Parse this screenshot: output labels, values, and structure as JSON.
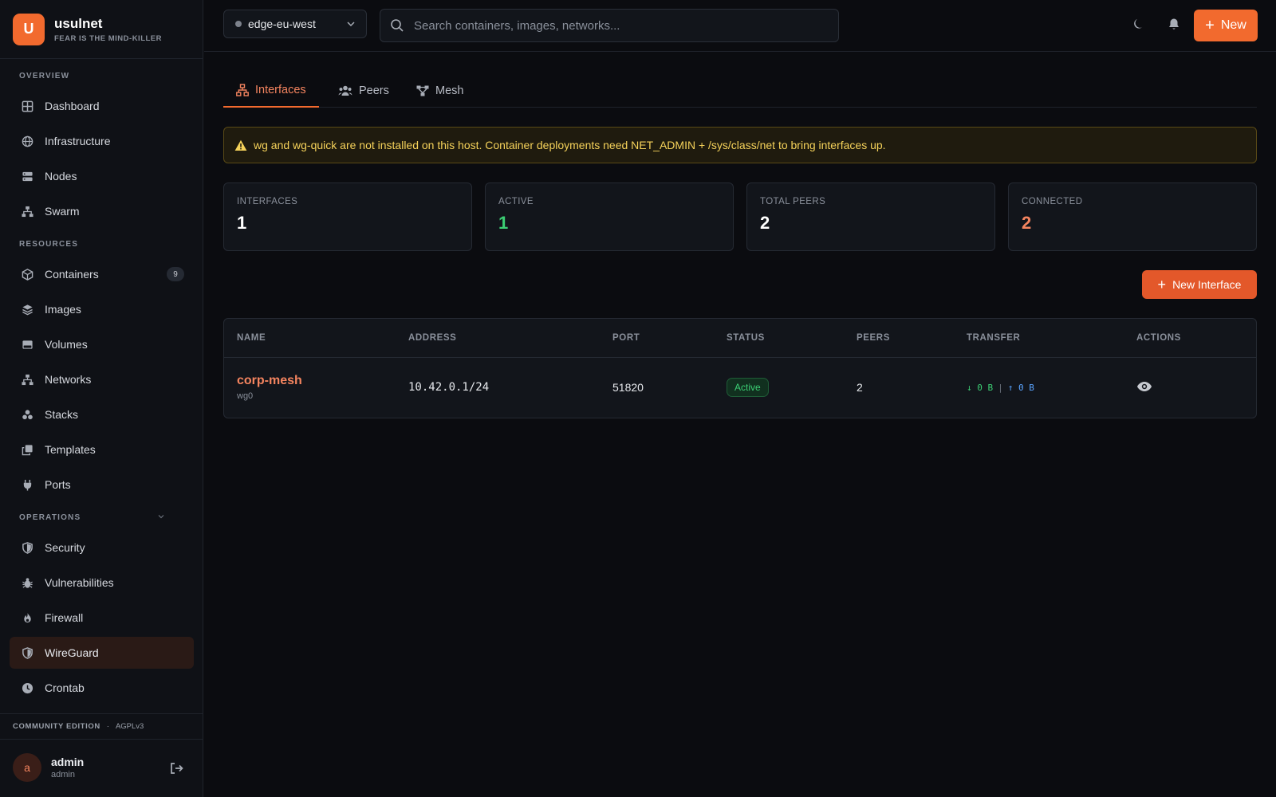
{
  "brand": {
    "logo_letter": "U",
    "name": "usulnet",
    "tagline": "FEAR IS THE MIND-KILLER"
  },
  "sidebar": {
    "sections": [
      {
        "label": "OVERVIEW"
      },
      {
        "label": "RESOURCES"
      },
      {
        "label": "OPERATIONS"
      }
    ],
    "items": [
      {
        "label": "Dashboard",
        "icon": "grid-icon"
      },
      {
        "label": "Infrastructure",
        "icon": "globe-icon"
      },
      {
        "label": "Nodes",
        "icon": "server-icon"
      },
      {
        "label": "Swarm",
        "icon": "network-icon"
      },
      {
        "label": "Containers",
        "icon": "box-icon",
        "badge": "9"
      },
      {
        "label": "Images",
        "icon": "layers-icon"
      },
      {
        "label": "Volumes",
        "icon": "hard-drive-icon"
      },
      {
        "label": "Networks",
        "icon": "network-icon"
      },
      {
        "label": "Stacks",
        "icon": "cubes-icon"
      },
      {
        "label": "Templates",
        "icon": "copy-icon"
      },
      {
        "label": "Ports",
        "icon": "plug-icon"
      },
      {
        "label": "Security",
        "icon": "shield-icon"
      },
      {
        "label": "Vulnerabilities",
        "icon": "bug-icon"
      },
      {
        "label": "Firewall",
        "icon": "fire-icon"
      },
      {
        "label": "WireGuard",
        "icon": "shield-icon",
        "active": true
      },
      {
        "label": "Crontab",
        "icon": "clock-icon"
      }
    ],
    "footer": {
      "edition": "COMMUNITY EDITION",
      "separator": "·",
      "license": "AGPLv3"
    },
    "user": {
      "initial": "a",
      "name": "admin",
      "role": "admin"
    }
  },
  "topbar": {
    "host": "edge-eu-west",
    "search_placeholder": "Search containers, images, networks...",
    "new_label": "New"
  },
  "tabs": [
    {
      "label": "Interfaces",
      "icon": "network-icon",
      "active": true
    },
    {
      "label": "Peers",
      "icon": "users-icon"
    },
    {
      "label": "Mesh",
      "icon": "mesh-icon"
    }
  ],
  "alert": {
    "text": "wg and wg-quick are not installed on this host. Container deployments need NET_ADMIN + /sys/class/net to bring interfaces up.",
    "color": "#f5d25a"
  },
  "stats": [
    {
      "label": "INTERFACES",
      "value": "1"
    },
    {
      "label": "ACTIVE",
      "value": "1",
      "color": "#3ccf74"
    },
    {
      "label": "TOTAL PEERS",
      "value": "2"
    },
    {
      "label": "CONNECTED",
      "value": "2",
      "color": "#f4845f"
    }
  ],
  "new_interface_label": "New Interface",
  "table": {
    "columns": [
      "NAME",
      "ADDRESS",
      "PORT",
      "STATUS",
      "PEERS",
      "TRANSFER",
      "ACTIONS"
    ],
    "rows": [
      {
        "name": "corp-mesh",
        "device": "wg0",
        "address": "10.42.0.1/24",
        "port": "51820",
        "status": "Active",
        "peers": "2",
        "rx": "↓ 0 B",
        "tx_sep": "|",
        "tx": "↑ 0 B"
      }
    ]
  },
  "colors": {
    "accent": "#f26a2e",
    "active_green": "#3ccf74",
    "warning_yellow": "#f5d25a"
  }
}
